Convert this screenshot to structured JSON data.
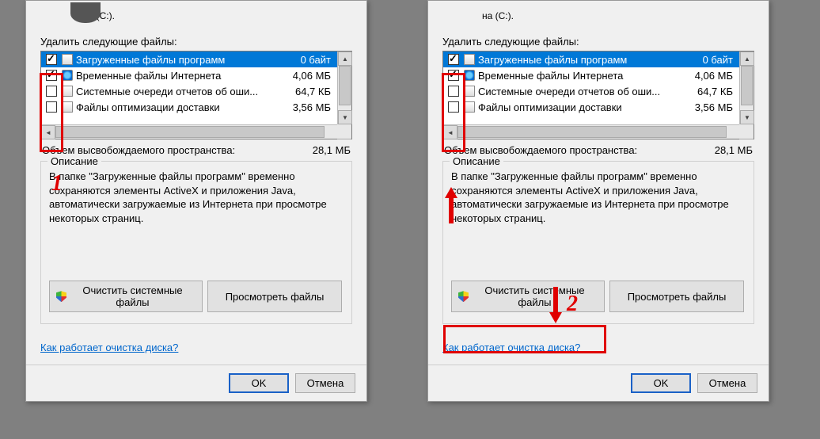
{
  "drive_line": "на (C:).",
  "files_label": "Удалить следующие файлы:",
  "items": [
    {
      "name": "Загруженные файлы программ",
      "size": "0 байт",
      "checked": true,
      "icon": "page"
    },
    {
      "name": "Временные файлы Интернета",
      "size": "4,06 МБ",
      "checked": true,
      "icon": "globe"
    },
    {
      "name": "Системные очереди отчетов об оши...",
      "size": "64,7 КБ",
      "checked": false,
      "icon": "page"
    },
    {
      "name": "Файлы оптимизации доставки",
      "size": "3,56 МБ",
      "checked": false,
      "icon": "page"
    }
  ],
  "total_label": "Объем высвобождаемого пространства:",
  "total_value": "28,1 МБ",
  "desc_legend": "Описание",
  "desc_text": "В папке \"Загруженные файлы программ\" временно сохраняются элементы ActiveX и приложения Java, автоматически загружаемые из Интернета при просмотре некоторых страниц.",
  "clean_button": "Очистить системные файлы",
  "view_button": "Просмотреть файлы",
  "help_link": "Как работает очистка диска?",
  "ok": "OK",
  "cancel": "Отмена",
  "anno1": "1",
  "anno2": "2"
}
